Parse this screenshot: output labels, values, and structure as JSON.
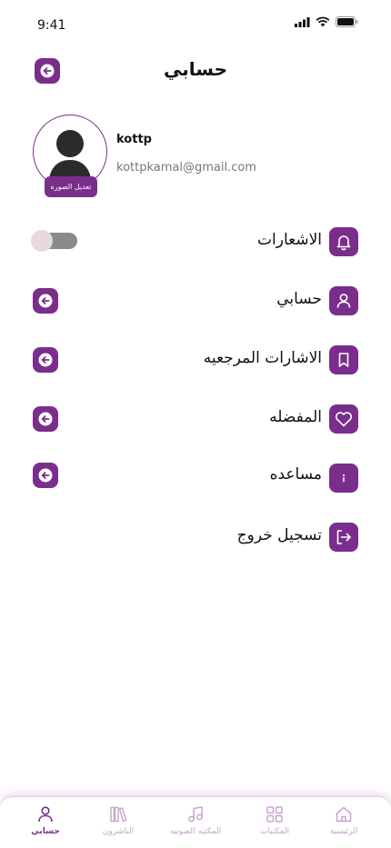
{
  "status": {
    "time": "9:41"
  },
  "header": {
    "title": "حسابي"
  },
  "profile": {
    "name": "kottp",
    "email": "kottpkamal@gmail.com",
    "edit_photo_label": "تعديل الصوره"
  },
  "menu": {
    "notifications": {
      "label": "الاشعارات",
      "toggle_on": false
    },
    "account": {
      "label": "حسابي"
    },
    "bookmarks": {
      "label": "الاشارات المرجعيه"
    },
    "favorites": {
      "label": "المفضله"
    },
    "help": {
      "label": "مساعده"
    },
    "logout": {
      "label": "تسجيل خروج"
    }
  },
  "bottom_nav": {
    "home": "الرئيسية",
    "libraries": "المكتبات",
    "audio_library": "المكتبه الصوتيه",
    "publishers": "الناشرون",
    "account": "حسابي",
    "active": "account"
  },
  "colors": {
    "accent": "#7a2e8c",
    "inactive_nav": "#c7a3cd",
    "toggle_track": "#8a8a8a"
  }
}
